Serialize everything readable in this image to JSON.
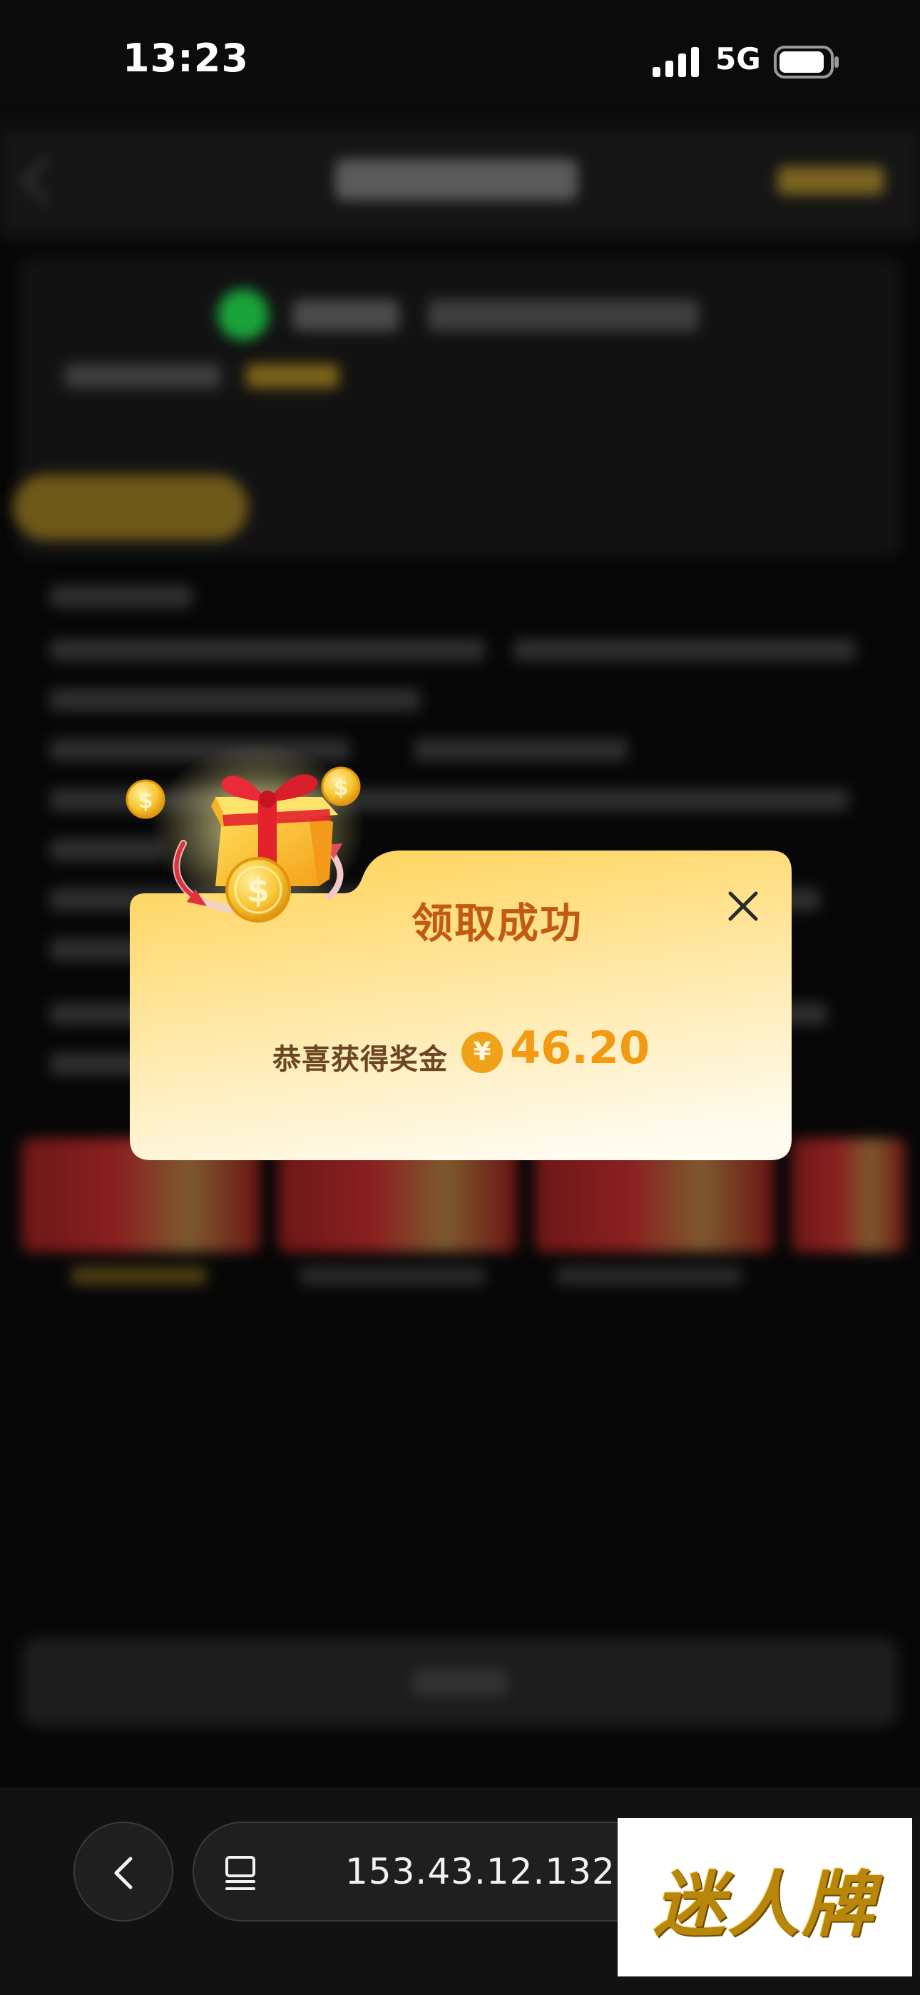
{
  "status_bar": {
    "time": "13:23",
    "network": "5G",
    "signal_icon": "signal-bars-icon",
    "battery_icon": "battery-icon"
  },
  "dialog": {
    "title": "领取成功",
    "reward_label": "恭喜获得奖金",
    "currency_symbol": "¥",
    "amount": "46.20",
    "close_icon": "close-icon",
    "gift_icon": "gift-box-coins-icon",
    "colors": {
      "title": "#c35a12",
      "amount": "#f29a14",
      "panel_top": "#ffd55e",
      "panel_bottom": "#fffbef"
    }
  },
  "browser_bar": {
    "back_icon": "chevron-left-icon",
    "tabs_icon": "tabs-icon",
    "address": "153.43.12.132"
  },
  "watermark": {
    "text": "迷人牌"
  }
}
